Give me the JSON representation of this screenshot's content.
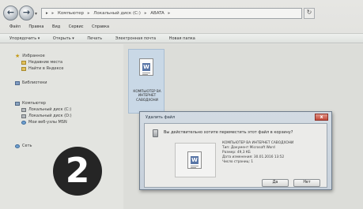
{
  "address": {
    "back_icon": "back-arrow-icon",
    "forward_icon": "forward-arrow-icon",
    "path": [
      "Компьютер",
      "Локальный диск (C:)",
      "ABATA"
    ],
    "refresh_icon": "refresh-icon"
  },
  "menu": [
    "Файл",
    "Правка",
    "Вид",
    "Сервис",
    "Справка"
  ],
  "toolbar": [
    "Упорядочить ▾",
    "Открыть ▾",
    "Печать",
    "Электронная почта",
    "Новая папка"
  ],
  "nav": {
    "favorites": "Избранное",
    "recent": "Недавние места",
    "yandex": "Найти в Яндексе",
    "libraries": "Библиотеки",
    "computer": "Компьютер",
    "disk_c": "Локальный диск (C:)",
    "disk_d": "Локальный диск (D:)",
    "msn": "Мои веб-узлы MSN",
    "network": "Сеть"
  },
  "file": {
    "name": "КОМПЬЮТЕР ВА ИНТЕРНЕТ САВОДХОНИ",
    "icon": "word-document-icon"
  },
  "dialog": {
    "title": "Удалить файл",
    "close": "x",
    "question": "Вы действительно хотите переместить этот файл в корзину?",
    "info_name": "КОМПЬЮТЕР ВА ИНТЕРНЕТ САВОДХОНИ",
    "info_type": "Тип: Документ Microsoft Word",
    "info_size": "Размер: 49,3 КБ",
    "info_date": "Дата изменения: 30.01.2016 13:52",
    "info_pages": "Число страниц: 1",
    "yes": "Да",
    "no": "Нет"
  },
  "step": "2"
}
